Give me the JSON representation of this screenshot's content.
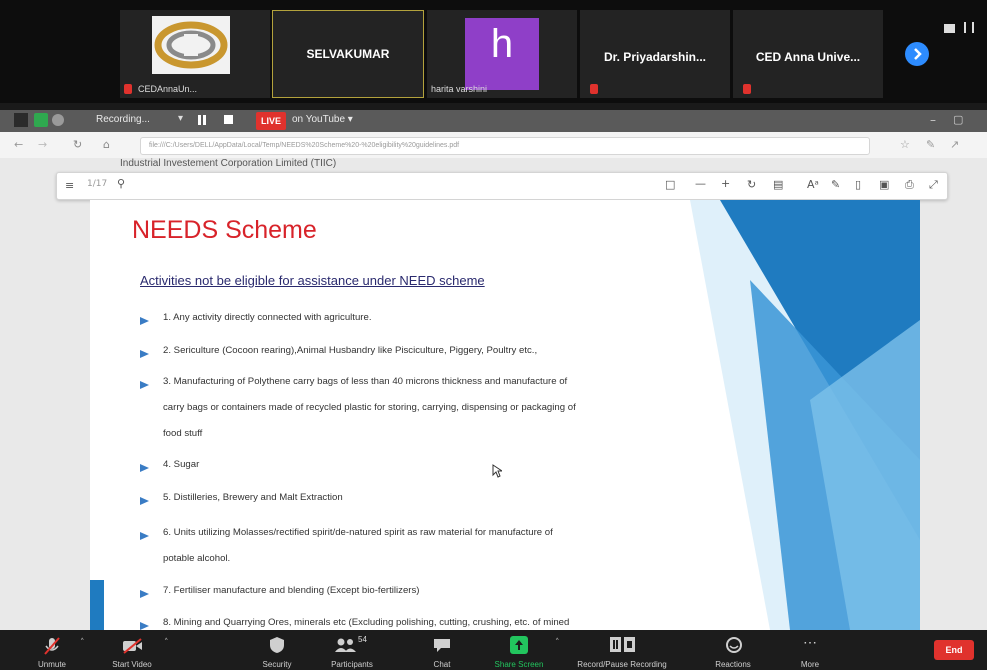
{
  "participants": {
    "tile1_label": "CEDAnnaUn...",
    "tile2_name": "SELVAKUMAR",
    "tile3_initial": "h",
    "tile3_label": "harita varshini",
    "tile4_name": "Dr. Priyadarshin...",
    "tile5_name": "CED Anna Unive..."
  },
  "recording": {
    "recording_label": "Recording...",
    "live_label": "LIVE",
    "youtube_label": "on YouTube ▾"
  },
  "browser": {
    "url": "file:///C:/Users/DELL/AppData/Local/Temp/NEEDS%20Scheme%20-%20eligibility%20guidelines.pdf"
  },
  "doc_header": "Industrial Investement Corporation Limited  (TIIC)",
  "slide": {
    "title": "NEEDS Scheme",
    "subtitle": "Activities not be eligible for assistance under NEED scheme",
    "items": [
      "1. Any activity directly connected with agriculture.",
      "2. Sericulture (Cocoon rearing),Animal Husbandry like Pisciculture, Piggery, Poultry etc.,",
      "3. Manufacturing of Polythene carry bags of less than 40 microns thickness and manufacture of",
      "carry bags or containers made of recycled plastic for storing, carrying, dispensing or packaging of",
      "food stuff",
      "4. Sugar",
      "5. Distilleries, Brewery and Malt Extraction",
      "6. Units utilizing Molasses/rectified spirit/de-natured spirit as raw material for manufacture of",
      "potable alcohol.",
      "7. Fertiliser manufacture and blending (Except bio-fertilizers)",
      "8. Mining and Quarrying Ores, minerals etc (Excluding polishing, cutting, crushing, etc. of mined"
    ]
  },
  "toolbar": {
    "unmute": "Unmute",
    "start_video": "Start Video",
    "security": "Security",
    "participants": "Participants",
    "participants_count": "54",
    "chat": "Chat",
    "share_screen": "Share Screen",
    "record": "Record/Pause Recording",
    "reactions": "Reactions",
    "more": "More",
    "end": "End"
  },
  "colors": {
    "title_red": "#d8232a",
    "live_red": "#e0322d",
    "share_green": "#22c55e",
    "end_red": "#e0322d",
    "slide_blue": "#1f7bc0"
  }
}
